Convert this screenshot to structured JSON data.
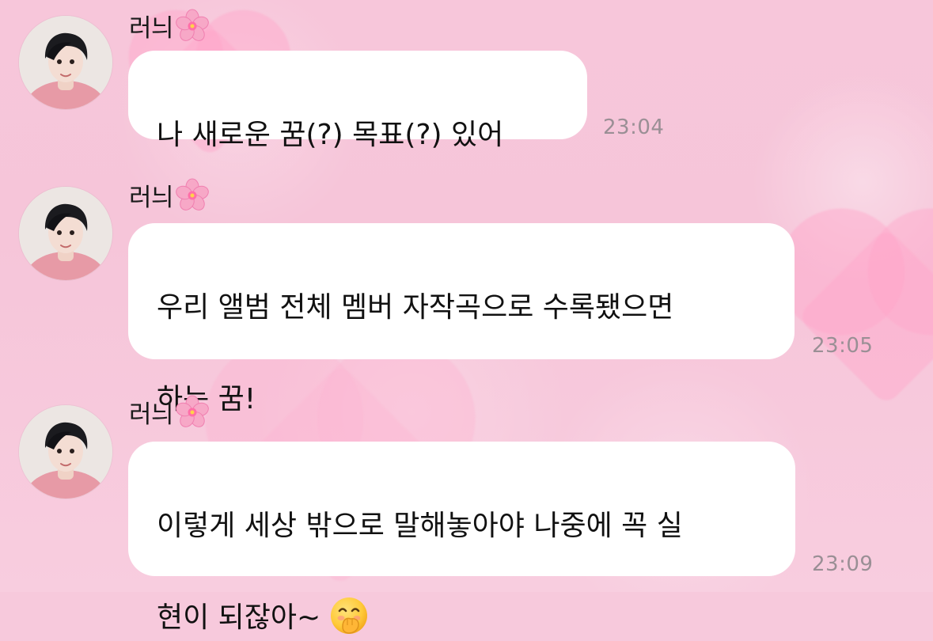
{
  "chat": {
    "messages": [
      {
        "sender": "러늬",
        "text": "나 새로운 꿈(?) 목표(?) 있어",
        "time": "23:04"
      },
      {
        "sender": "러늬",
        "text_line1": "우리 앨범 전체 멤버 자작곡으로 수록됐으면",
        "text_line2": "하는 꿈!",
        "time": "23:05"
      },
      {
        "sender": "러늬",
        "text_line1": "이렇게 세상 밖으로 말해놓아야 나중에 꼭 실",
        "text_line2": "현이 되잖아~",
        "time": "23:09"
      }
    ],
    "sender_badge_icon": "cherry-blossom-icon",
    "inline_emoji_icon": "hand-over-mouth-emoji-icon"
  },
  "colors": {
    "background": "#f7c9dc",
    "bubble": "#ffffff",
    "timestamp": "#9a8f95"
  }
}
